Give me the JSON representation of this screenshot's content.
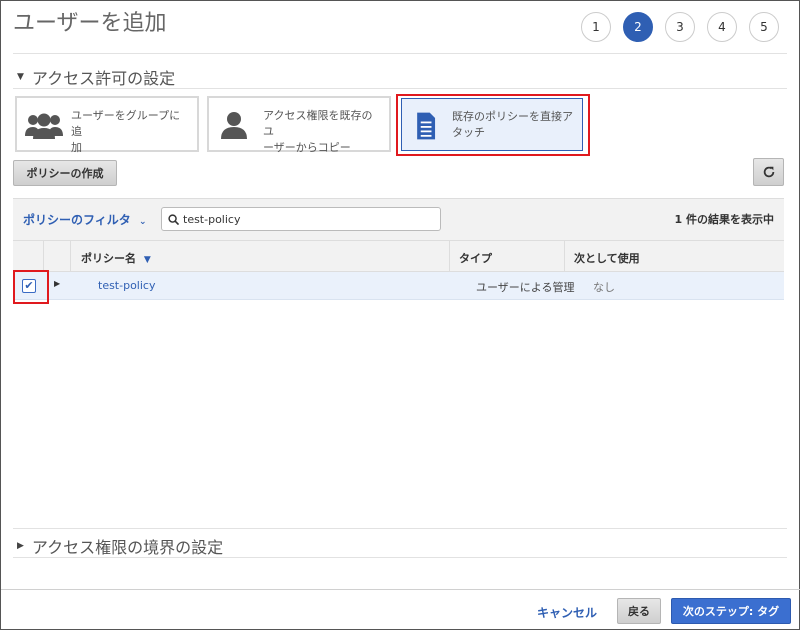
{
  "header": {
    "title": "ユーザーを追加"
  },
  "steps": [
    "1",
    "2",
    "3",
    "4",
    "5"
  ],
  "active_step": "2",
  "permissions_section": {
    "title": "アクセス許可の設定",
    "options": [
      {
        "line1": "ユーザーをグループに追",
        "line2": "加",
        "icon": "group-icon"
      },
      {
        "line1": "アクセス権限を既存のユ",
        "line2": "ーザーからコピー",
        "icon": "user-icon"
      },
      {
        "line1": "既存のポリシーを直接ア",
        "line2": "タッチ",
        "icon": "document-icon",
        "selected": true
      }
    ]
  },
  "toolbar": {
    "create_policy_label": "ポリシーの作成",
    "refresh_icon": "refresh-icon"
  },
  "filter": {
    "label": "ポリシーのフィルタ",
    "search_value": "test-policy",
    "result_count": "1 件の結果を表示中"
  },
  "table": {
    "columns": {
      "name": "ポリシー名",
      "type": "タイプ",
      "usage": "次として使用"
    },
    "rows": [
      {
        "checked": true,
        "name": "test-policy",
        "type": "ユーザーによる管理",
        "usage": "なし"
      }
    ]
  },
  "boundary_section": {
    "title": "アクセス権限の境界の設定"
  },
  "footer": {
    "cancel_label": "キャンセル",
    "back_label": "戻る",
    "next_label": "次のステップ: タグ"
  },
  "colors": {
    "accent": "#2f5fb3",
    "highlight": "#e0191e",
    "selected_bg": "#e9f0fb"
  }
}
